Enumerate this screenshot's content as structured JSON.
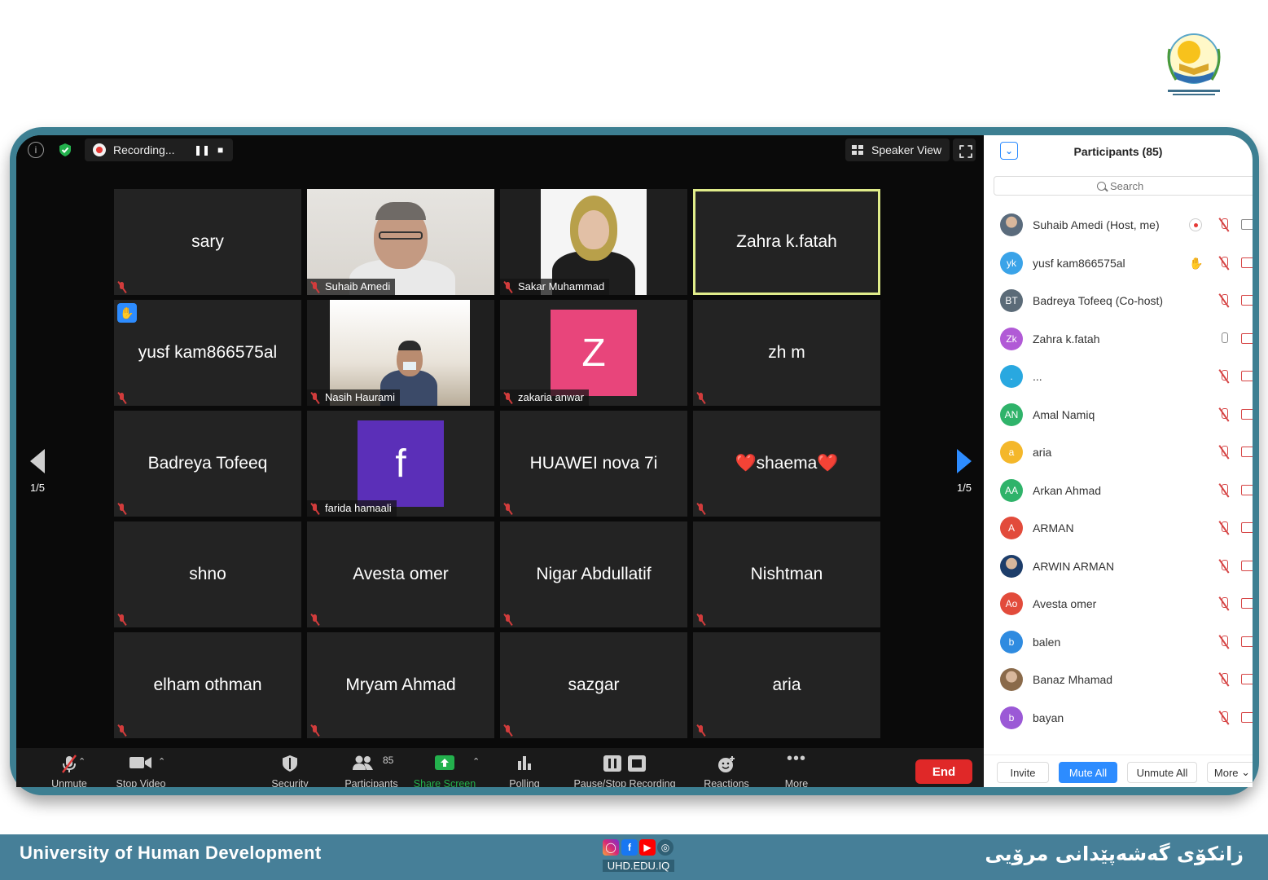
{
  "topbar": {
    "recording_label": "Recording...",
    "speaker_view_label": "Speaker View"
  },
  "nav": {
    "left_page": "1/5",
    "right_page": "1/5"
  },
  "tiles": [
    {
      "name": "sary",
      "type": "name"
    },
    {
      "name": "Suhaib Amedi",
      "type": "video"
    },
    {
      "name": "Sakar Muhammad",
      "type": "video"
    },
    {
      "name": "Zahra k.fatah",
      "type": "name",
      "active": true
    },
    {
      "name": "yusf kam866575al",
      "type": "name",
      "hand": true
    },
    {
      "name": "Nasih Haurami",
      "type": "video"
    },
    {
      "name": "zakaria anwar",
      "type": "avatar",
      "letter": "Z",
      "color": "#e8457b"
    },
    {
      "name": "zh m",
      "type": "name"
    },
    {
      "name": "Badreya Tofeeq",
      "type": "name"
    },
    {
      "name": "farida hamaali",
      "type": "avatar",
      "letter": "f",
      "color": "#5b2fb8"
    },
    {
      "name": "HUAWEI nova 7i",
      "type": "name"
    },
    {
      "name": "❤️shaema❤️",
      "type": "name"
    },
    {
      "name": "shno",
      "type": "name"
    },
    {
      "name": "Avesta omer",
      "type": "name"
    },
    {
      "name": "Nigar Abdullatif",
      "type": "name"
    },
    {
      "name": "Nishtman",
      "type": "name"
    },
    {
      "name": "elham othman",
      "type": "name"
    },
    {
      "name": "Mryam Ahmad",
      "type": "name"
    },
    {
      "name": "sazgar",
      "type": "name"
    },
    {
      "name": "aria",
      "type": "name"
    }
  ],
  "toolbar": {
    "unmute": "Unmute",
    "stop_video": "Stop Video",
    "security": "Security",
    "participants": "Participants",
    "participants_count": "85",
    "share_screen": "Share Screen",
    "polling": "Polling",
    "pause_stop_recording": "Pause/Stop Recording",
    "reactions": "Reactions",
    "more": "More",
    "end": "End"
  },
  "panel": {
    "title": "Participants (85)",
    "search_placeholder": "Search",
    "participants": [
      {
        "name": "Suhaib Amedi (Host, me)",
        "initials": "",
        "color": "#5a6b7c",
        "photo": true,
        "mic": "off",
        "extra": "rec"
      },
      {
        "name": "yusf kam866575al",
        "initials": "yk",
        "color": "#3aa3e8",
        "mic": "off",
        "extra": "hand"
      },
      {
        "name": "Badreya Tofeeq (Co-host)",
        "initials": "BT",
        "color": "#5b6b78",
        "mic": "off"
      },
      {
        "name": "Zahra k.fatah",
        "initials": "Zk",
        "color": "#b15ad6",
        "mic": "on"
      },
      {
        "name": "...",
        "initials": ".",
        "color": "#29a8e0",
        "mic": "off"
      },
      {
        "name": "Amal Namiq",
        "initials": "AN",
        "color": "#2fb36a",
        "mic": "off"
      },
      {
        "name": "aria",
        "initials": "a",
        "color": "#f4b72a",
        "mic": "off"
      },
      {
        "name": "Arkan Ahmad",
        "initials": "AA",
        "color": "#2fb36a",
        "mic": "off"
      },
      {
        "name": "ARMAN",
        "initials": "A",
        "color": "#e24b3b",
        "mic": "off"
      },
      {
        "name": "ARWIN ARMAN",
        "initials": "",
        "color": "#1d3d6a",
        "photo": true,
        "mic": "off"
      },
      {
        "name": "Avesta omer",
        "initials": "Ao",
        "color": "#e24b3b",
        "mic": "off"
      },
      {
        "name": "balen",
        "initials": "b",
        "color": "#2f8be0",
        "mic": "off"
      },
      {
        "name": "Banaz Mhamad",
        "initials": "",
        "color": "#8a6a4a",
        "photo": true,
        "mic": "off"
      },
      {
        "name": "bayan",
        "initials": "b",
        "color": "#9b59d6",
        "mic": "off"
      }
    ],
    "invite": "Invite",
    "mute_all": "Mute All",
    "unmute_all": "Unmute All",
    "more": "More"
  },
  "footer": {
    "university_en": "University of Human Development",
    "university_ku": "زانکۆی گەشەپێدانی مرۆیی",
    "website": "UHD.EDU.IQ"
  }
}
